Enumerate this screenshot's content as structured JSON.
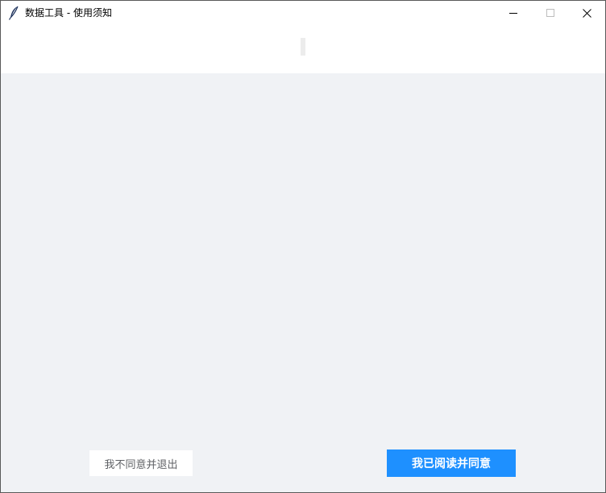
{
  "window": {
    "title": "数据工具 - 使用须知",
    "app_icon": "feather-icon",
    "controls": {
      "minimize_icon": "minimize-icon",
      "maximize_icon": "maximize-icon",
      "close_icon": "close-icon"
    }
  },
  "actions": {
    "disagree_label": "我不同意并退出",
    "agree_label": "我已阅读并同意"
  },
  "colors": {
    "content_bg": "#f0f2f5",
    "primary": "#1e90ff",
    "secondary_text": "#606266"
  }
}
